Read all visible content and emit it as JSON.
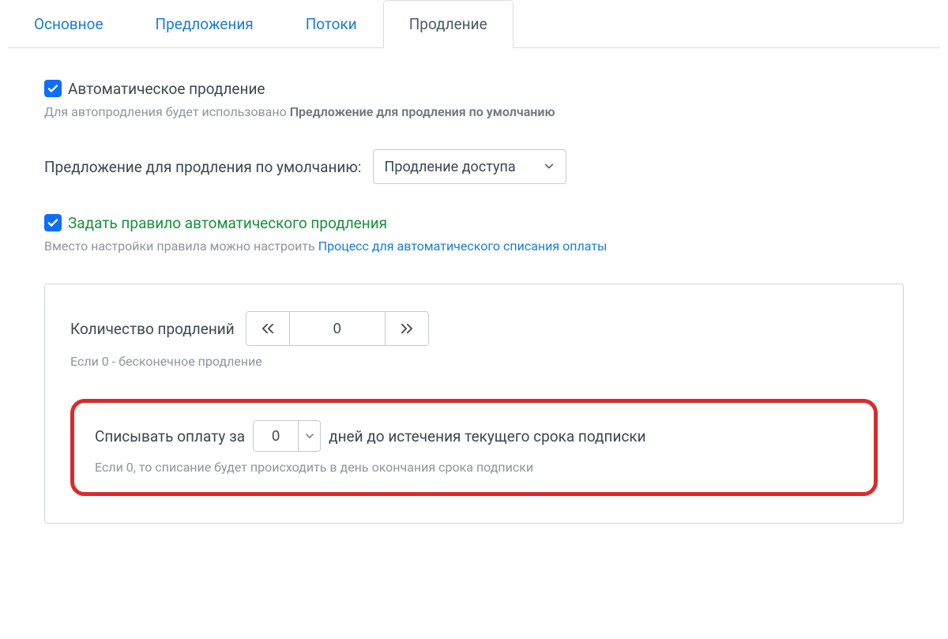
{
  "tabs": {
    "items": [
      {
        "label": "Основное",
        "active": false
      },
      {
        "label": "Предложения",
        "active": false
      },
      {
        "label": "Потоки",
        "active": false
      },
      {
        "label": "Продление",
        "active": true
      }
    ]
  },
  "auto_renew": {
    "checked": true,
    "label": "Автоматическое продление",
    "help_prefix": "Для автопродления будет использовано ",
    "help_bold": "Предложение для продления по умолчанию"
  },
  "default_offer": {
    "label": "Предложение для продления по умолчанию:",
    "value": "Продление доступа"
  },
  "set_rule": {
    "checked": true,
    "label": "Задать правило автоматического продления",
    "help_prefix": "Вместо настройки правила можно настроить ",
    "help_link": "Процесс для автоматического списания оплаты"
  },
  "renewals_count": {
    "label": "Количество продлений",
    "value": "0",
    "help": "Если 0 - бесконечное продление"
  },
  "charge_before": {
    "prefix": "Списывать оплату за",
    "value": "0",
    "suffix": "дней до истечения текущего срока подписки",
    "help": "Если 0, то списание будет происходить в день окончания срока подписки"
  }
}
